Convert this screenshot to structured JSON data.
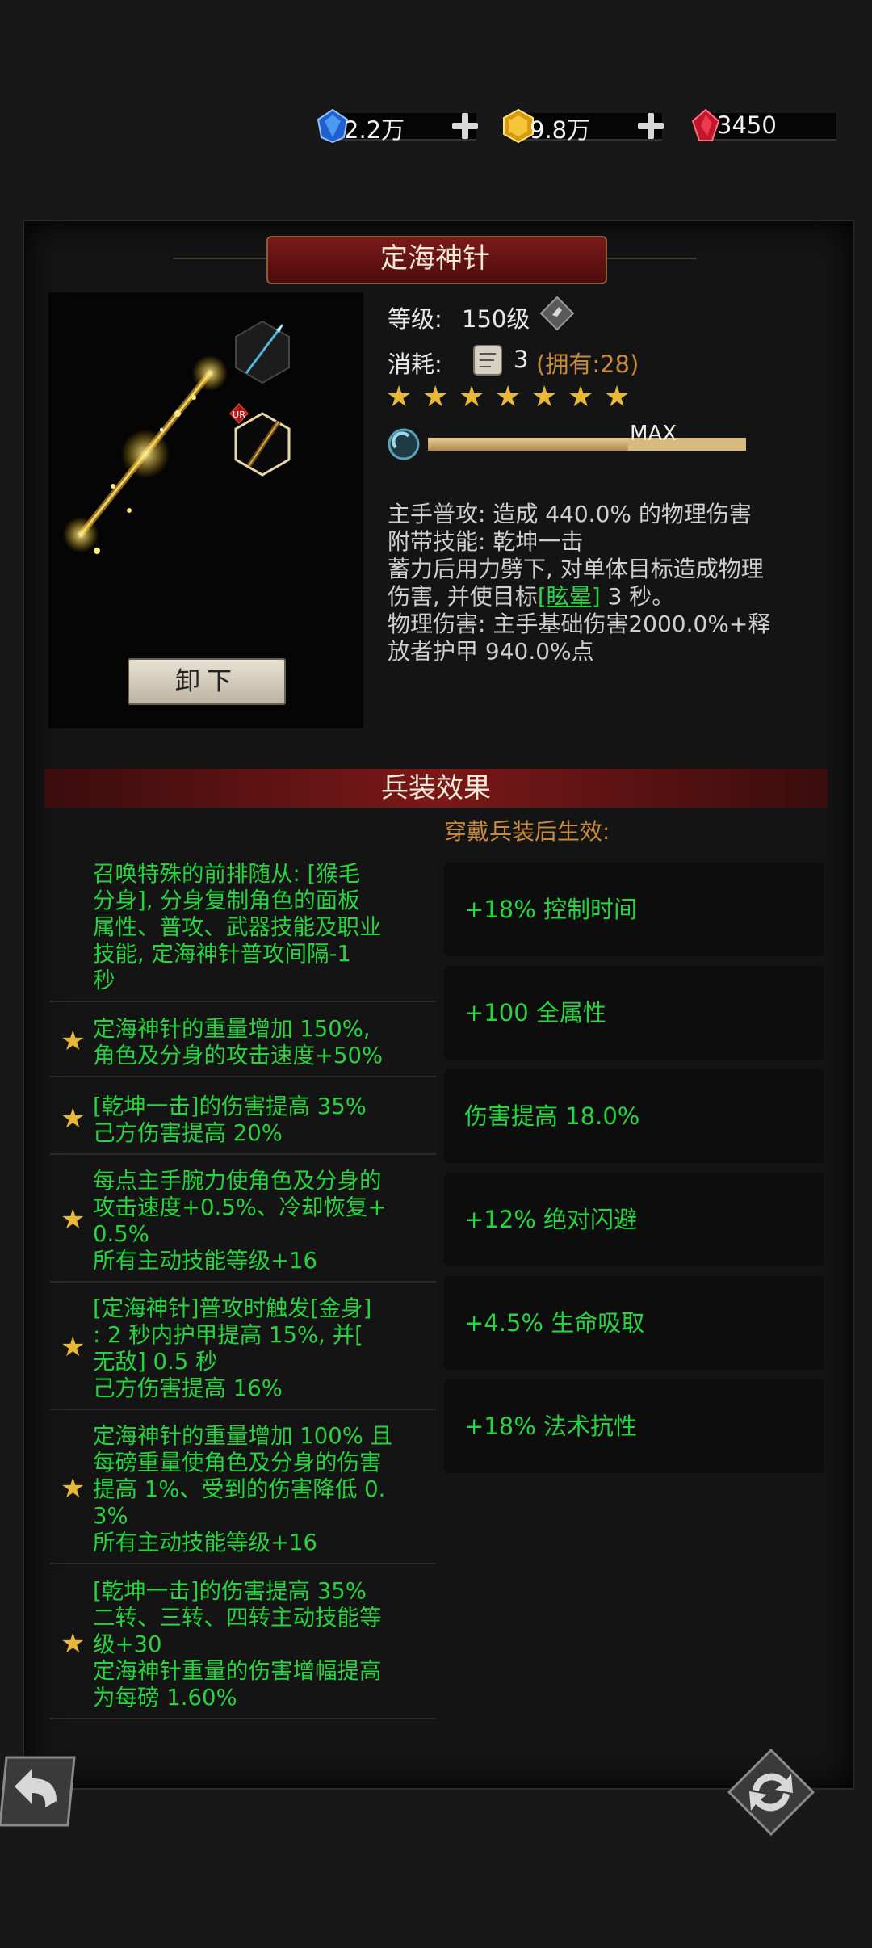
{
  "currency": {
    "blue_gem": {
      "value": "2.2万",
      "icon": "blue-diamond-icon"
    },
    "gold_gem": {
      "value": "9.8万",
      "icon": "gold-gem-icon"
    },
    "red_gem": {
      "value": "3450",
      "icon": "red-crystal-icon"
    }
  },
  "item": {
    "title": "定海神针",
    "level_label": "等级:",
    "level_value": "150级",
    "cost_label": "消耗:",
    "cost_amount": "3",
    "cost_owned": "(拥有:28)",
    "stars": 7,
    "progress_label": "MAX",
    "progress_fraction": 0.63,
    "unequip_label": "卸下",
    "rarity_badge": "UR",
    "desc": {
      "line1": "主手普攻: 造成 440.0% 的物理伤害",
      "line2": "附带技能: 乾坤一击",
      "line3": "蓄力后用力劈下, 对单体目标造成物理",
      "line4a": "伤害, 并使目标",
      "line4b": "[眩晕]",
      "line4c": " 3 秒。",
      "line5": "物理伤害: 主手基础伤害2000.0%+释",
      "line6": "放者护甲 940.0%点"
    }
  },
  "effects": {
    "title": "兵装效果",
    "wear_note": "穿戴兵装后生效:",
    "list": [
      {
        "lines": [
          "召唤特殊的前排随从: [猴毛",
          "分身], 分身复制角色的面板",
          "属性、普攻、武器技能及职业",
          "技能, 定海神针普攻间隔-1",
          "秒"
        ]
      },
      {
        "lines": [
          "定海神针的重量增加 150%,",
          "角色及分身的攻击速度+50%"
        ]
      },
      {
        "lines": [
          "[乾坤一击]的伤害提高 35%",
          "己方伤害提高 20%"
        ]
      },
      {
        "lines": [
          "每点主手腕力使角色及分身的",
          "攻击速度+0.5%、冷却恢复+",
          "0.5%",
          "所有主动技能等级+16"
        ]
      },
      {
        "lines": [
          "[定海神针]普攻时触发[金身]",
          ": 2 秒内护甲提高 15%, 并[",
          "无敌] 0.5 秒",
          "己方伤害提高 16%"
        ]
      },
      {
        "lines": [
          "定海神针的重量增加 100% 且",
          "每磅重量使角色及分身的伤害",
          "提高 1%、受到的伤害降低 0.",
          "3%",
          "所有主动技能等级+16"
        ]
      },
      {
        "lines": [
          "[乾坤一击]的伤害提高 35%",
          "二转、三转、四转主动技能等",
          "级+30",
          "定海神针重量的伤害增幅提高",
          "为每磅 1.60%"
        ]
      }
    ],
    "bonuses": [
      "+18% 控制时间",
      "+100 全属性",
      "伤害提高 18.0%",
      "+12% 绝对闪避",
      "+4.5% 生命吸取",
      "+18% 法术抗性"
    ]
  },
  "nav": {
    "back_icon": "back-arrow-icon",
    "refresh_icon": "refresh-cycle-icon"
  }
}
